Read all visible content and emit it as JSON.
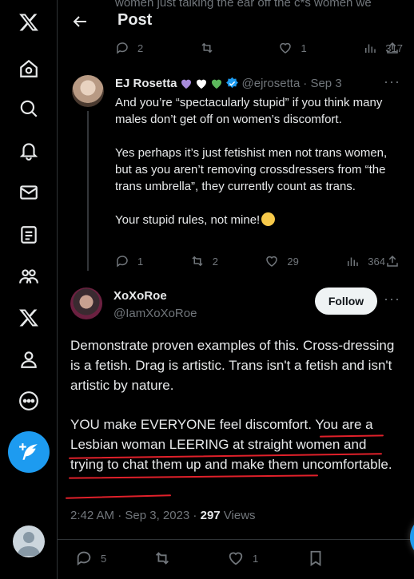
{
  "header": {
    "title": "Post",
    "ghost_text": "women just talking the ear off the c*s women we"
  },
  "parent_actions": {
    "replies": "2",
    "reposts": "",
    "likes": "1",
    "views": "317"
  },
  "reply": {
    "name": "EJ Rosetta",
    "handle": "@ejrosetta",
    "date": "· Sep 3",
    "paragraphs": [
      "And you’re “spectacularly stupid” if you think many males don’t get off on women’s discomfort.",
      "Yes perhaps it’s just fetishist men not trans women, but as you aren’t removing crossdressers from “the trans umbrella”, they currently count as trans.",
      "Your stupid rules, not mine!"
    ],
    "actions": {
      "replies": "1",
      "reposts": "2",
      "likes": "29",
      "views": "364"
    },
    "heart_colors": [
      "#a78bdb",
      "#ffffff",
      "#5cb85c"
    ]
  },
  "post": {
    "name": "XoXoRoe",
    "handle": "@IamXoXoRoe",
    "follow_label": "Follow",
    "paragraph1": "Demonstrate proven examples of this.  Cross-dressing is a fetish. Drag is artistic. Trans isn't a fetish and isn't artistic by nature.",
    "paragraph2": "YOU make EVERYONE feel discomfort. You are a Lesbian woman LEERING at straight women and trying to chat them up and make them uncomfortable.",
    "time": "2:42 AM · Sep 3, 2023 · ",
    "views_count": "297",
    "views_label": " Views",
    "actions": {
      "replies": "5",
      "reposts": "",
      "likes": "1"
    }
  },
  "colors": {
    "accent": "#1d9bf0",
    "annotation": "#e0202a"
  },
  "icons": [
    "x-logo-icon",
    "home-icon",
    "search-icon",
    "bell-icon",
    "mail-icon",
    "lists-icon",
    "communities-icon",
    "premium-x-icon",
    "profile-icon",
    "more-icon",
    "compose-icon",
    "back-arrow-icon",
    "reply-icon",
    "repost-icon",
    "like-icon",
    "views-icon",
    "share-icon",
    "bookmark-icon",
    "verified-icon",
    "messages-icon"
  ]
}
